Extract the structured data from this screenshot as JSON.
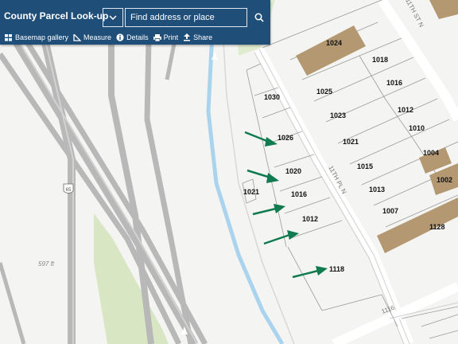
{
  "toolbar": {
    "title": "County Parcel Look-up",
    "search_placeholder": "Find address or place",
    "tools": {
      "basemap_gallery": "Basemap gallery",
      "measure": "Measure",
      "details": "Details",
      "print": "Print",
      "share": "Share"
    }
  },
  "map": {
    "parcels": [
      "1024",
      "1018",
      "1025",
      "1016",
      "1030",
      "1023",
      "1012",
      "1010",
      "1026",
      "1021",
      "1004",
      "1015",
      "1020",
      "1002",
      "1021",
      "1016",
      "1013",
      "1007",
      "1012",
      "1128",
      "1118"
    ],
    "street_labels": [
      "11TH PL N",
      "11TH ST N",
      "1116"
    ],
    "highway_shield": "65",
    "elevation": "597 ft",
    "colors": {
      "building": "#b39872",
      "water": "#aad3ee",
      "park": "#d8e6c4",
      "arrow": "#0f7b4f",
      "toolbar": "#1f4e79"
    }
  }
}
